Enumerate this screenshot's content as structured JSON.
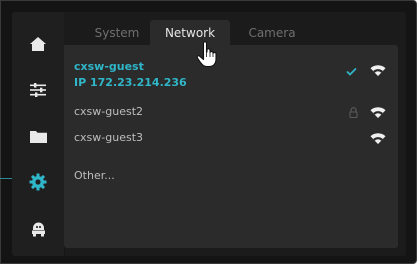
{
  "nav": {
    "items": [
      {
        "icon": "home-icon",
        "active": false
      },
      {
        "icon": "sliders-icon",
        "active": false
      },
      {
        "icon": "folder-icon",
        "active": false
      },
      {
        "icon": "gear-icon",
        "active": true
      },
      {
        "icon": "robot-icon",
        "active": false
      }
    ]
  },
  "tabs": [
    {
      "label": "System",
      "active": false
    },
    {
      "label": "Network",
      "active": true
    },
    {
      "label": "Camera",
      "active": false
    }
  ],
  "networks": [
    {
      "ssid": "cxsw-guest",
      "ip": "IP 172.23.214.236",
      "connected": true,
      "locked": false,
      "icon": "wifi-icon"
    },
    {
      "ssid": "cxsw-guest2",
      "connected": false,
      "locked": true,
      "icon": "wifi-icon"
    },
    {
      "ssid": "cxsw-guest3",
      "connected": false,
      "locked": false,
      "icon": "wifi-icon"
    }
  ],
  "other_label": "Other...",
  "colors": {
    "accent": "#2fb6c8",
    "text": "#bdbdbd",
    "panel": "#2b2b2b",
    "background": "#1b1b1b"
  }
}
